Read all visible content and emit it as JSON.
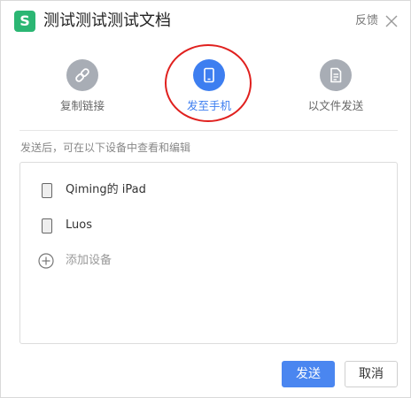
{
  "window": {
    "app_icon_letter": "S",
    "title": "测试测试测试文档",
    "feedback_label": "反馈",
    "close_icon": "close-icon"
  },
  "share_options": [
    {
      "label": "复制链接",
      "icon": "link-icon",
      "active": false
    },
    {
      "label": "发至手机",
      "icon": "tablet-icon",
      "active": true
    },
    {
      "label": "以文件发送",
      "icon": "document-icon",
      "active": false
    }
  ],
  "hint_text": "发送后，可在以下设备中查看和编辑",
  "devices": [
    {
      "name": "Qiming的 iPad",
      "icon": "tablet-icon"
    },
    {
      "name": "Luos",
      "icon": "tablet-icon"
    }
  ],
  "add_device_label": "添加设备",
  "buttons": {
    "send": "发送",
    "cancel": "取消"
  },
  "colors": {
    "accent": "#3d7ef0",
    "app_icon": "#2bb673",
    "highlight_ring": "#e0201e",
    "inactive_icon": "#a8adb5"
  }
}
